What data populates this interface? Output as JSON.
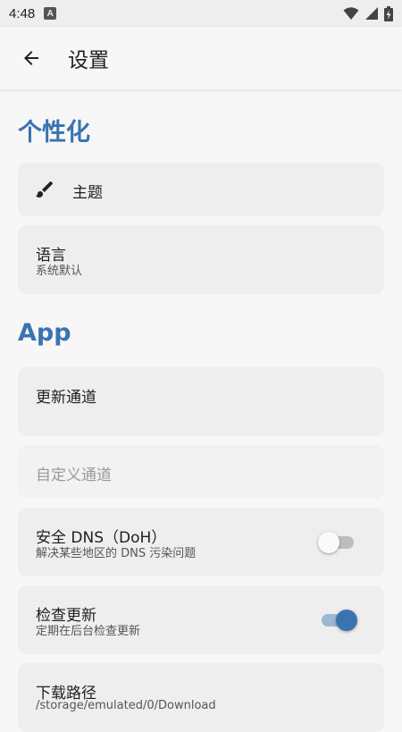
{
  "status_bar": {
    "time": "4:48",
    "indicator": "A"
  },
  "app_bar": {
    "title": "设置"
  },
  "sections": {
    "personalize": {
      "title": "个性化"
    },
    "app": {
      "title": "App"
    }
  },
  "items": {
    "theme": {
      "title": "主题",
      "icon": "brush-icon"
    },
    "language": {
      "title": "语言",
      "subtitle": "系统默认"
    },
    "update_channel": {
      "title": "更新通道"
    },
    "custom_channel": {
      "placeholder": "自定义通道"
    },
    "secure_dns": {
      "title": "安全 DNS（DoH）",
      "subtitle": "解决某些地区的 DNS 污染问题",
      "enabled": false
    },
    "check_updates": {
      "title": "检查更新",
      "subtitle": "定期在后台检查更新",
      "enabled": true
    },
    "download_path": {
      "title": "下载路径",
      "subtitle": "/storage/emulated/0/Download"
    }
  },
  "colors": {
    "accent": "#3a73b0",
    "card": "#eeeeee",
    "background": "#f7f7f7"
  }
}
